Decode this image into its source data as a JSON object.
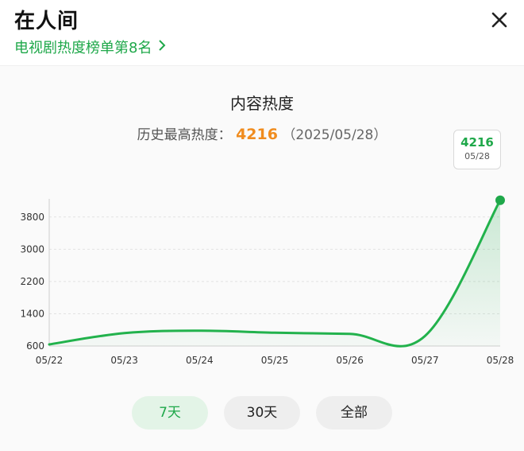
{
  "header": {
    "title": "在人间",
    "subtitle": "电视剧热度榜单第8名",
    "close_icon": "close-icon",
    "chevron_icon": "chevron-right-icon"
  },
  "heat": {
    "title": "内容热度",
    "peak_label": "历史最高热度：",
    "peak_value": "4216",
    "peak_date": "（2025/05/28）"
  },
  "tooltip": {
    "value": "4216",
    "date": "05/28"
  },
  "tabs": [
    {
      "label": "7天",
      "active": true
    },
    {
      "label": "30天",
      "active": false
    },
    {
      "label": "全部",
      "active": false
    }
  ],
  "colors": {
    "accent": "#1fa84a",
    "peak": "#f08c1e"
  },
  "chart_data": {
    "type": "area",
    "x": [
      "05/22",
      "05/23",
      "05/24",
      "05/25",
      "05/26",
      "05/27",
      "05/28"
    ],
    "ylim": [
      600,
      4250
    ],
    "yticks": [
      600,
      1400,
      2200,
      3000,
      3800
    ],
    "series": [
      {
        "values": [
          640,
          920,
          980,
          930,
          900,
          850,
          4216
        ]
      }
    ],
    "grid": true
  }
}
